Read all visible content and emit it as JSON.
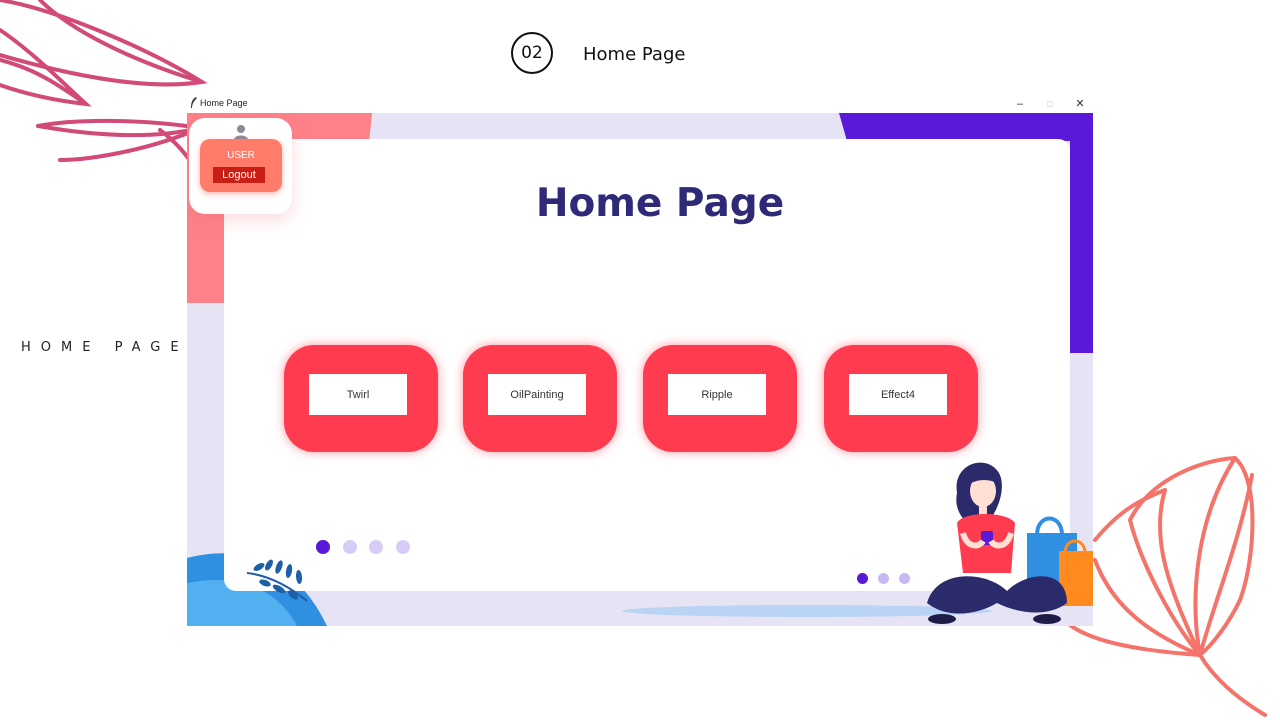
{
  "slide": {
    "number": "02",
    "title": "Home Page",
    "side_label": "HOME PAGE"
  },
  "window": {
    "title": "Home Page",
    "minimize_glyph": "–",
    "maximize_glyph": "□",
    "close_glyph": "✕"
  },
  "app": {
    "heading": "Home Page",
    "user_label": "USER",
    "logout_label": "Logout",
    "effects": [
      "Twirl",
      "OilPainting",
      "Ripple",
      "Effect4"
    ]
  },
  "colors": {
    "accent_red": "#fe3b4f",
    "heading_navy": "#2e2a78",
    "purple": "#5a19d9",
    "deco_pink": "#d24a78",
    "deco_coral": "#f4736a"
  },
  "icons": [
    "feather-icon",
    "user-icon",
    "leaf-icon",
    "shopping-bag-icon"
  ]
}
